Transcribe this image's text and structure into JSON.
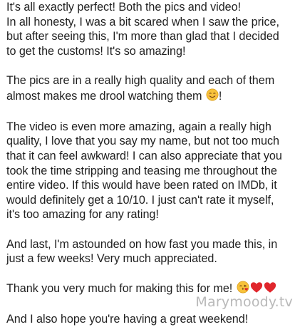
{
  "message": {
    "paragraphs": [
      {
        "lines": [
          "It's all exactly perfect! Both the pics and video!",
          "In all honesty, I was a bit scared when I saw the price,",
          "but after seeing this, I'm more than glad that I decided",
          "to get the customs! It's so amazing!"
        ]
      },
      {
        "lines": [
          "The pics are in a really high quality and each of them",
          "almost makes me drool watching them",
          "!"
        ],
        "emoji": [
          "smiling-face-icon"
        ]
      },
      {
        "lines": [
          "The video is even more amazing, again a really high",
          "quality, I love that you say my name, but not too much",
          "that it can feel awkward! I can also appreciate that you",
          "took the time stripping and teasing me throughout the",
          "entire video. If this would have been rated on IMDb, it",
          "would definitely get a 10/10. I just can't rate it myself,",
          "it's too amazing for any rating!"
        ]
      },
      {
        "lines": [
          "And last, I'm astounded on how fast you made this, in",
          "just a few weeks! Very much appreciated."
        ]
      },
      {
        "lines": [
          "Thank you very much for making this for me!"
        ],
        "emoji": [
          "kiss-face-icon",
          "red-heart-icon",
          "red-heart-icon"
        ]
      },
      {
        "lines": [
          "And I also hope you're having a great weekend!"
        ]
      }
    ]
  },
  "watermark": "Marymoody.tv",
  "colors": {
    "text": "#1f1f1f",
    "watermark": "#b9b9b9",
    "heart": "#e0262c",
    "emoji_face": "#f7c23a"
  }
}
